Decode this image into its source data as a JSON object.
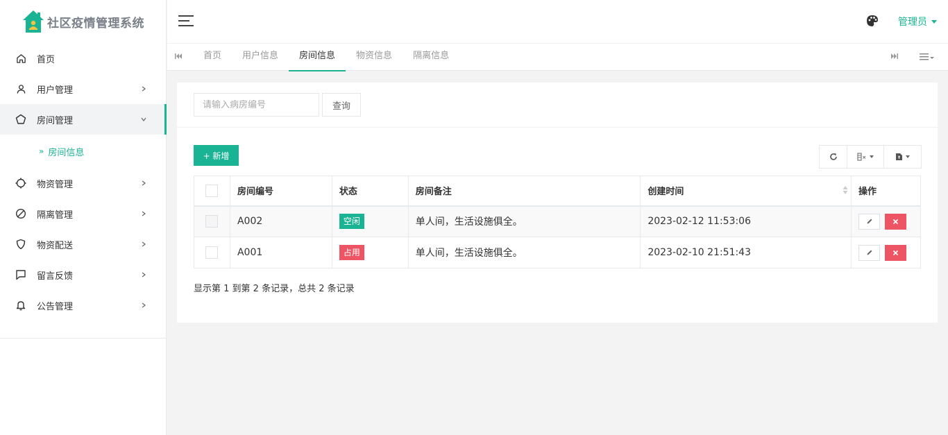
{
  "app": {
    "title": "社区疫情管理系统"
  },
  "colors": {
    "accent": "#1ab394",
    "free": "#1ab394",
    "occupied": "#ed5565"
  },
  "sidebar": {
    "items": [
      {
        "label": "首页",
        "icon": "home-icon"
      },
      {
        "label": "用户管理",
        "icon": "user-icon"
      },
      {
        "label": "房间管理",
        "icon": "pentagon-icon",
        "active": true
      },
      {
        "label": "物资管理",
        "icon": "gear-icon"
      },
      {
        "label": "隔离管理",
        "icon": "ban-icon"
      },
      {
        "label": "物资配送",
        "icon": "shield-icon"
      },
      {
        "label": "留言反馈",
        "icon": "message-icon"
      },
      {
        "label": "公告管理",
        "icon": "bell-icon"
      }
    ],
    "subitem": {
      "marker": "»",
      "label": "房间信息"
    }
  },
  "header": {
    "user": "管理员"
  },
  "tabs": [
    {
      "label": "首页"
    },
    {
      "label": "用户信息"
    },
    {
      "label": "房间信息",
      "active": true
    },
    {
      "label": "物资信息"
    },
    {
      "label": "隔离信息"
    }
  ],
  "search": {
    "placeholder": "请输入病房编号",
    "button": "查询"
  },
  "toolbar": {
    "add_label": "+ 新增"
  },
  "table": {
    "columns": [
      "房间编号",
      "状态",
      "房间备注",
      "创建时间",
      "操作"
    ],
    "rows": [
      {
        "id": "A002",
        "status": "空闲",
        "note": "单人间，生活设施俱全。",
        "created": "2023-02-12 11:53:06"
      },
      {
        "id": "A001",
        "status": "占用",
        "note": "单人间，生活设施俱全。",
        "created": "2023-02-10 21:51:43"
      }
    ]
  },
  "pagination": {
    "summary": "显示第 1 到第 2 条记录，总共 2 条记录"
  }
}
